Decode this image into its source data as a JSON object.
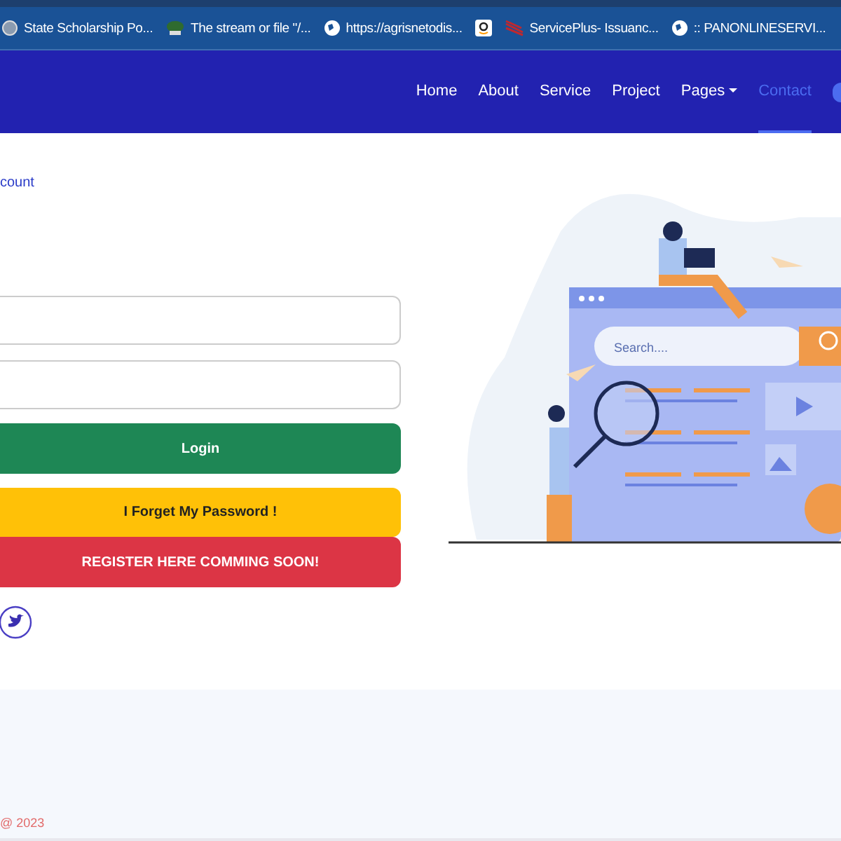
{
  "bookmarks": [
    {
      "label": "State Scholarship Po...",
      "kind": "link"
    },
    {
      "label": "The stream or file \"/...",
      "kind": "link"
    },
    {
      "label": "https://agrisnetodis...",
      "kind": "link"
    },
    {
      "kind": "icon-only"
    },
    {
      "label": "ServicePlus- Issuanc...",
      "kind": "link"
    },
    {
      "label": ":: PANONLINESERVI...",
      "kind": "link"
    }
  ],
  "nav": {
    "items": [
      {
        "label": "Home",
        "selected": false,
        "dropdown": false
      },
      {
        "label": "About",
        "selected": false,
        "dropdown": false
      },
      {
        "label": "Service",
        "selected": false,
        "dropdown": false
      },
      {
        "label": "Project",
        "selected": false,
        "dropdown": false
      },
      {
        "label": "Pages",
        "selected": false,
        "dropdown": true
      },
      {
        "label": "Contact",
        "selected": true,
        "dropdown": false
      }
    ]
  },
  "login": {
    "heading": "count",
    "buttons": [
      {
        "label": "Login",
        "kind": "success"
      },
      {
        "label": "I Forget My Password !",
        "kind": "warning"
      },
      {
        "label": "REGISTER HERE COMMING SOON!",
        "kind": "danger"
      }
    ]
  },
  "illustration": {
    "search_text": "Search...."
  },
  "footer": {
    "copyright": "@ 2023"
  }
}
